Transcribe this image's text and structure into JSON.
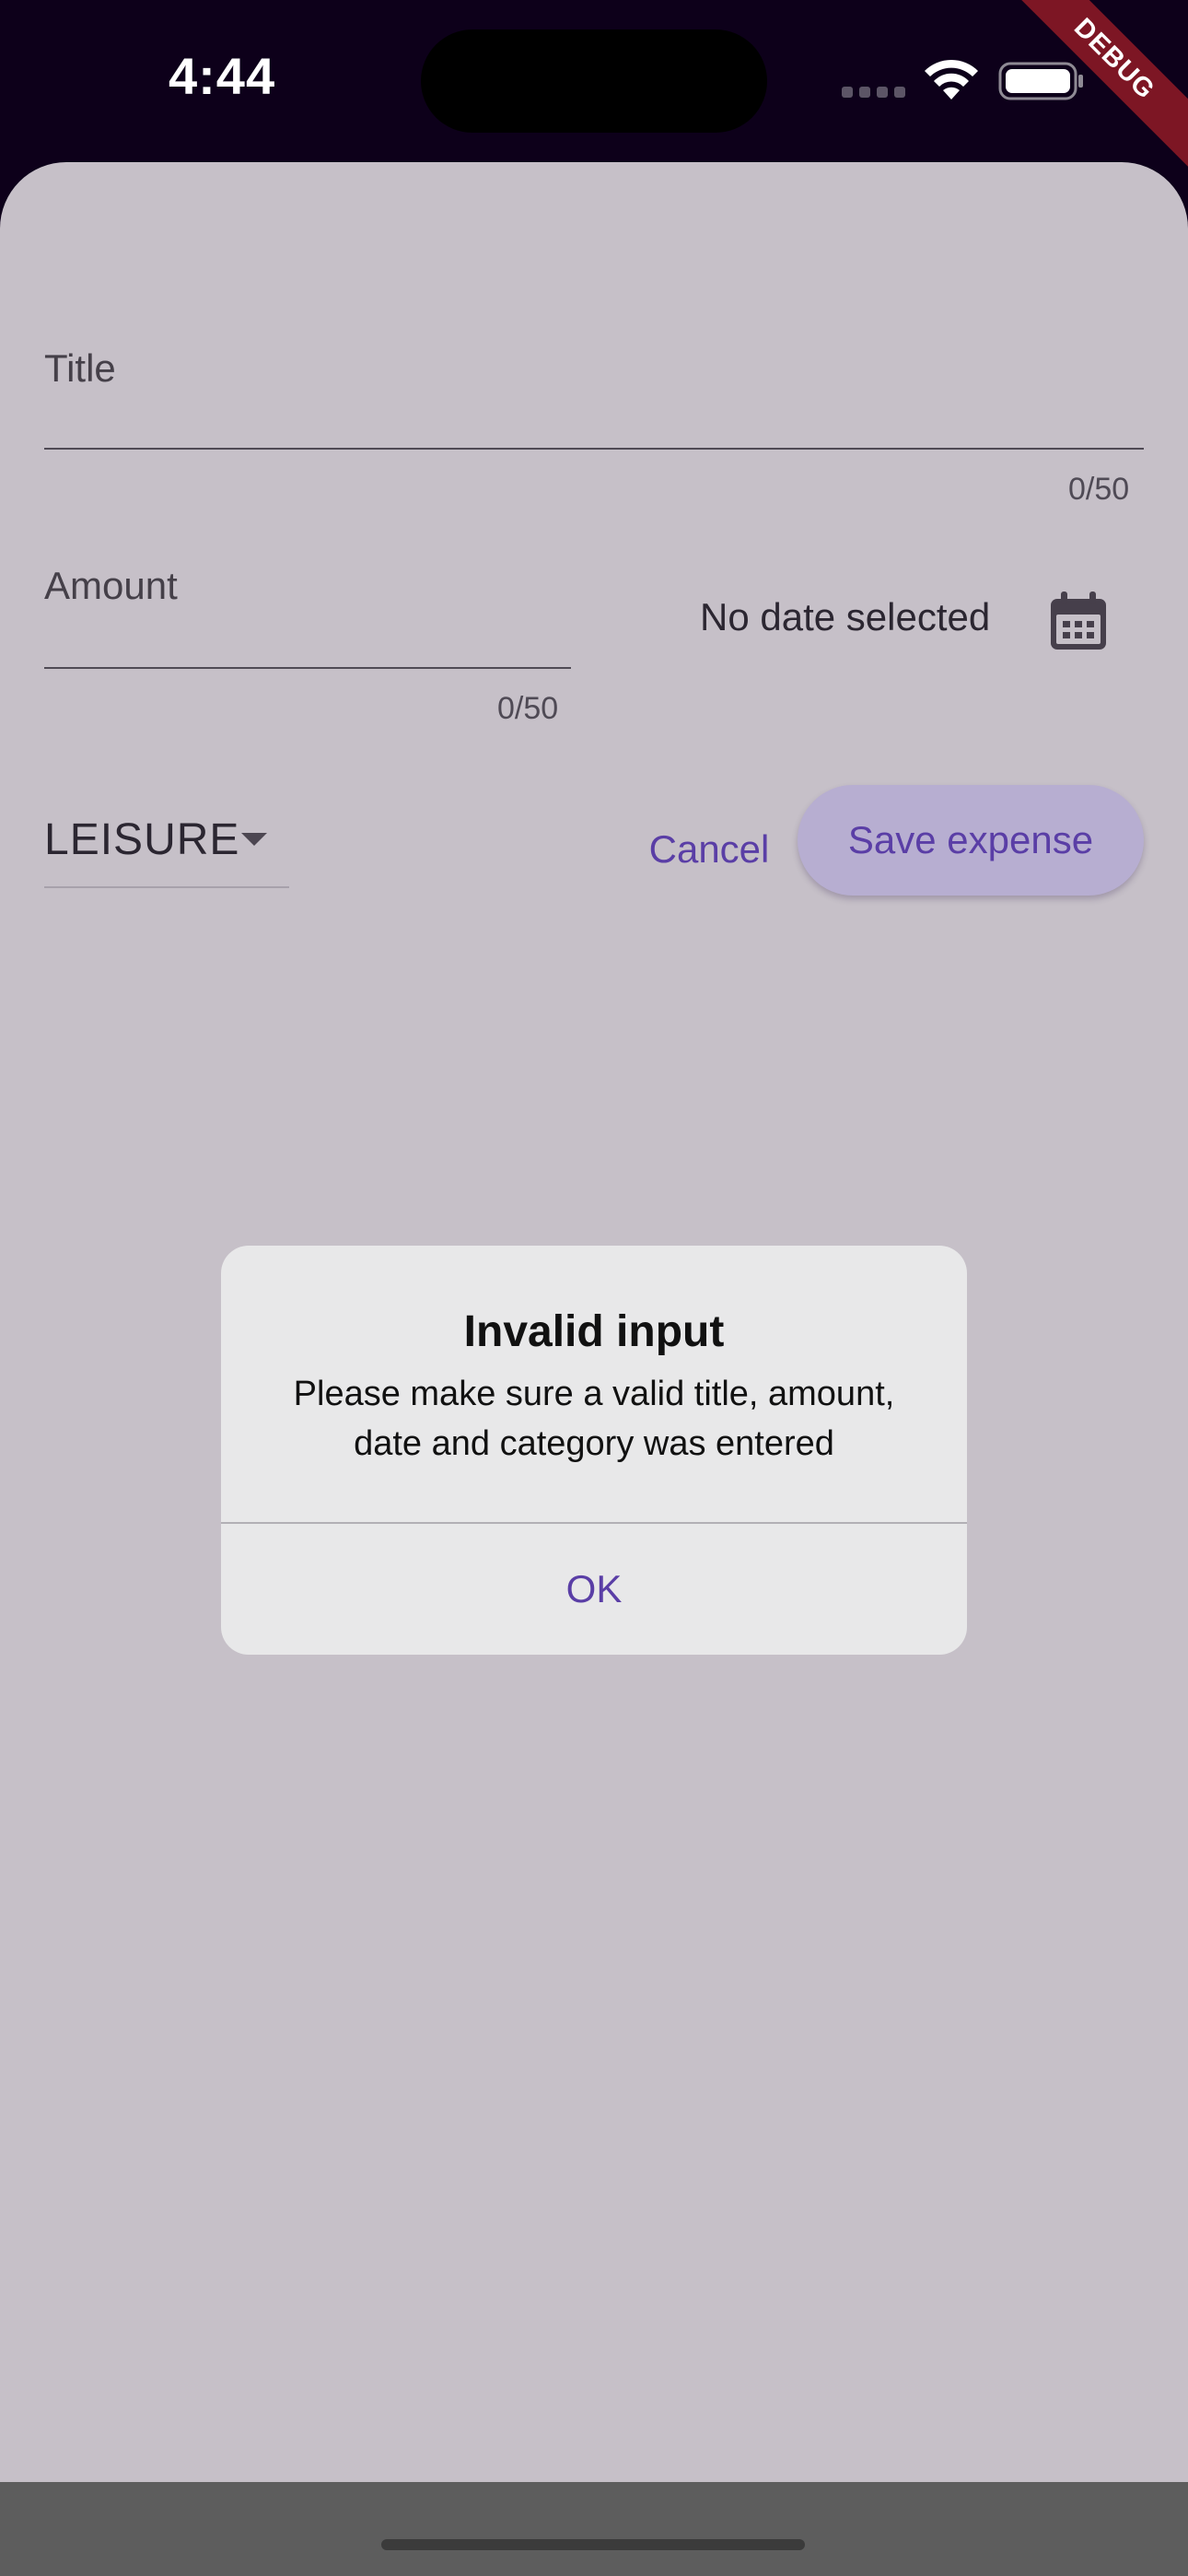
{
  "status_bar": {
    "time": "4:44",
    "debug_label": "DEBUG",
    "icons": [
      "cellular-signal-icon",
      "wifi-icon",
      "battery-icon"
    ]
  },
  "form": {
    "title_field": {
      "label": "Title",
      "value": "",
      "counter": "0/50"
    },
    "amount_field": {
      "label": "Amount",
      "value": "",
      "counter": "0/50"
    },
    "date": {
      "text": "No date selected",
      "icon": "calendar-icon"
    },
    "category": {
      "selected": "LEISURE",
      "icon": "dropdown-arrow-icon"
    },
    "buttons": {
      "cancel": "Cancel",
      "save": "Save expense"
    }
  },
  "dialog": {
    "title": "Invalid input",
    "message": "Please make sure a valid title, amount, date and category was entered",
    "ok_label": "OK"
  },
  "colors": {
    "status_bar_background": "#0d001a",
    "sheet_background": "#c6c0c8",
    "accent": "#5a3ea6",
    "save_button_background": "#b7aed1",
    "dialog_background": "#e8e8e9",
    "debug_ribbon": "#7d1624"
  }
}
